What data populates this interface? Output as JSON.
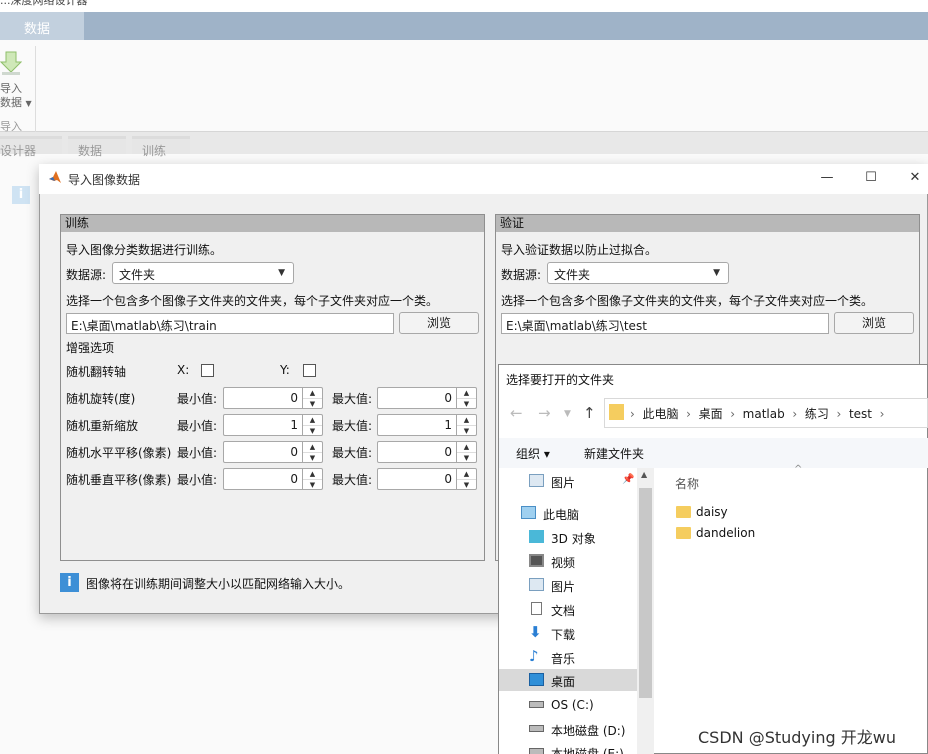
{
  "app": {
    "top_strip_title": "...深度网络设计器",
    "top_tab": "数据",
    "import_label_1": "导入",
    "import_label_2": "数据",
    "import_group": "导入",
    "doc_tabs": [
      "设计器",
      "数据",
      "训练"
    ]
  },
  "dialog": {
    "title": "导入图像数据",
    "train": {
      "header": "训练",
      "desc": "导入图像分类数据进行训练。",
      "source_label": "数据源:",
      "source_value": "文件夹",
      "folder_hint": "选择一个包含多个图像子文件夹的文件夹，每个子文件夹对应一个类。",
      "path": "E:\\桌面\\matlab\\练习\\train",
      "browse": "浏览",
      "aug_title": "增强选项",
      "flip_label": "随机翻转轴",
      "x_label": "X:",
      "y_label": "Y:",
      "rows": [
        {
          "label": "随机旋转(度)",
          "min_label": "最小值:",
          "min": "0",
          "max_label": "最大值:",
          "max": "0"
        },
        {
          "label": "随机重新缩放",
          "min_label": "最小值:",
          "min": "1",
          "max_label": "最大值:",
          "max": "1"
        },
        {
          "label": "随机水平平移(像素)",
          "min_label": "最小值:",
          "min": "0",
          "max_label": "最大值:",
          "max": "0"
        },
        {
          "label": "随机垂直平移(像素)",
          "min_label": "最小值:",
          "min": "0",
          "max_label": "最大值:",
          "max": "0"
        }
      ]
    },
    "val": {
      "header": "验证",
      "desc": "导入验证数据以防止过拟合。",
      "source_label": "数据源:",
      "source_value": "文件夹",
      "folder_hint": "选择一个包含多个图像子文件夹的文件夹，每个子文件夹对应一个类。",
      "path": "E:\\桌面\\matlab\\练习\\test",
      "browse": "浏览"
    },
    "note": "图像将在训练期间调整大小以匹配网络输入大小。"
  },
  "file_dialog": {
    "title": "选择要打开的文件夹",
    "breadcrumb": [
      "此电脑",
      "桌面",
      "matlab",
      "练习",
      "test"
    ],
    "organize": "组织 ▾",
    "new_folder": "新建文件夹",
    "column_name": "名称",
    "nav_items": [
      {
        "label": "图片",
        "icon": "pictures-icon"
      },
      {
        "label": "此电脑",
        "icon": "computer-icon"
      },
      {
        "label": "3D 对象",
        "icon": "3d-objects-icon"
      },
      {
        "label": "视频",
        "icon": "video-icon"
      },
      {
        "label": "图片",
        "icon": "pictures-icon"
      },
      {
        "label": "文档",
        "icon": "document-icon"
      },
      {
        "label": "下载",
        "icon": "download-icon"
      },
      {
        "label": "音乐",
        "icon": "music-icon"
      },
      {
        "label": "桌面",
        "icon": "desktop-icon"
      },
      {
        "label": "OS (C:)",
        "icon": "drive-icon"
      },
      {
        "label": "本地磁盘 (D:)",
        "icon": "drive-icon"
      },
      {
        "label": "本地磁盘 (E:)",
        "icon": "drive-icon"
      }
    ],
    "files": [
      "daisy",
      "dandelion"
    ]
  },
  "watermark": "CSDN @Studying 开龙wu"
}
